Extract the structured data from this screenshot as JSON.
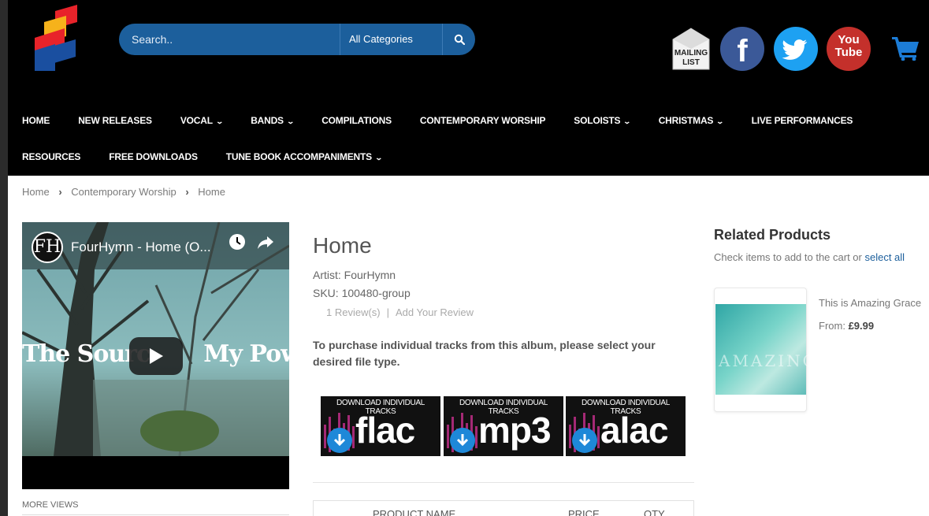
{
  "header": {
    "search_placeholder": "Search..",
    "category_select": "All Categories",
    "mailing_list_label_1": "MAILING",
    "mailing_list_label_2": "LIST",
    "facebook_glyph": "f",
    "youtube_label_1": "You",
    "youtube_label_2": "Tube"
  },
  "nav": {
    "row1": [
      {
        "label": "HOME",
        "dropdown": ""
      },
      {
        "label": "NEW RELEASES",
        "dropdown": ""
      },
      {
        "label": "VOCAL",
        "dropdown": "⌄"
      },
      {
        "label": "BANDS",
        "dropdown": "⌄"
      },
      {
        "label": "COMPILATIONS",
        "dropdown": ""
      },
      {
        "label": "CONTEMPORARY WORSHIP",
        "dropdown": ""
      },
      {
        "label": "SOLOISTS",
        "dropdown": "⌄"
      },
      {
        "label": "CHRISTMAS",
        "dropdown": "⌄"
      },
      {
        "label": "LIVE PERFORMANCES",
        "dropdown": ""
      }
    ],
    "row2": [
      {
        "label": "RESOURCES",
        "dropdown": ""
      },
      {
        "label": "FREE DOWNLOADS",
        "dropdown": ""
      },
      {
        "label": "TUNE BOOK ACCOMPANIMENTS",
        "dropdown": "⌄"
      }
    ]
  },
  "breadcrumb": {
    "items": [
      "Home",
      "Contemporary Worship",
      "Home"
    ],
    "separator": "›"
  },
  "video": {
    "channel_initials": "FH",
    "title": "FourHymn - Home (O...",
    "overlay_left": "The Sourc",
    "overlay_right": "My Power"
  },
  "more_views": "MORE VIEWS",
  "product": {
    "title": "Home",
    "artist": "Artist: FourHymn",
    "sku": "SKU: 100480-group",
    "review_count": "1 Review(s)",
    "review_separator": "|",
    "add_review": "Add Your Review",
    "purchase_text": "To purchase individual tracks from this album, please select your desired file type.",
    "download_caption": "DOWNLOAD INDIVIDUAL TRACKS",
    "formats": [
      "flac",
      "mp3",
      "alac"
    ]
  },
  "table_headers": {
    "product_name": "PRODUCT NAME",
    "price": "PRICE",
    "qty": "QTY"
  },
  "related": {
    "heading": "Related Products",
    "check_text": "Check items to add to the cart or ",
    "select_all": "select all",
    "items": [
      {
        "title": "This is Amazing Grace",
        "price_label": "From:",
        "price": "£9.99",
        "art_text": "AMAZING"
      }
    ]
  },
  "colors": {
    "header_bg": "#000000",
    "search_bg": "#1c5f9c",
    "facebook": "#3b5998",
    "twitter": "#1da1f2",
    "youtube": "#c4302b",
    "cart": "#1c7cd6",
    "download_arrow": "#1e88d8"
  }
}
